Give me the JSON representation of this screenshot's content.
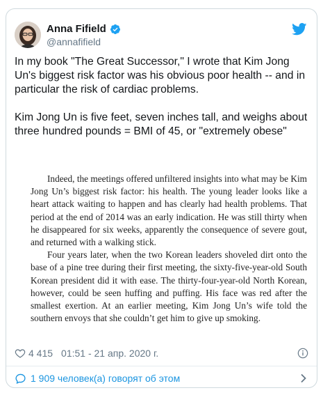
{
  "author": {
    "name": "Anna Fifield",
    "handle": "@annafifield",
    "verified": true
  },
  "tweet": {
    "paragraphs": [
      "In my book \"The Great Successor,\" I wrote that Kim Jong Un's biggest risk factor was his obvious poor health -- and in particular the risk of cardiac problems.",
      "Kim Jong Un is five feet, seven inches tall, and weighs about three hundred pounds = BMI of 45, or \"extremely obese\""
    ]
  },
  "media": {
    "paragraphs": [
      "Indeed, the meetings offered unfiltered insights into what may be Kim Jong Un’s biggest risk factor: his health. The young leader looks like a heart attack waiting to happen and has clearly had health problems. That period at the end of 2014 was an early indication. He was still thirty when he disappeared for six weeks, apparently the consequence of severe gout, and returned with a walking stick.",
      "Four years later, when the two Korean leaders shoveled dirt onto the base of a pine tree during their first meeting, the sixty-five-year-old South Korean president did it with ease. The thirty-four-year-old North Korean, however, could be seen huffing and puffing. His face was red after the smallest exertion. At an earlier meeting, Kim Jong Un’s wife told the southern envoys that she couldn’t get him to give up smoking."
    ]
  },
  "meta": {
    "likes": "4 415",
    "timestamp": "01:51 - 21 апр. 2020 г."
  },
  "footer": {
    "discussion": "1 909 человек(а) говорят об этом"
  },
  "icons": {
    "heart": "heart-icon",
    "info": "info-icon",
    "twitter": "twitter-bird-icon",
    "verified": "verified-badge-icon",
    "reply": "speech-bubble-icon",
    "chevron": "chevron-right-icon"
  },
  "colors": {
    "accent": "#1da1f2",
    "link": "#1b95e0",
    "text": "#14171a",
    "muted": "#657786"
  }
}
